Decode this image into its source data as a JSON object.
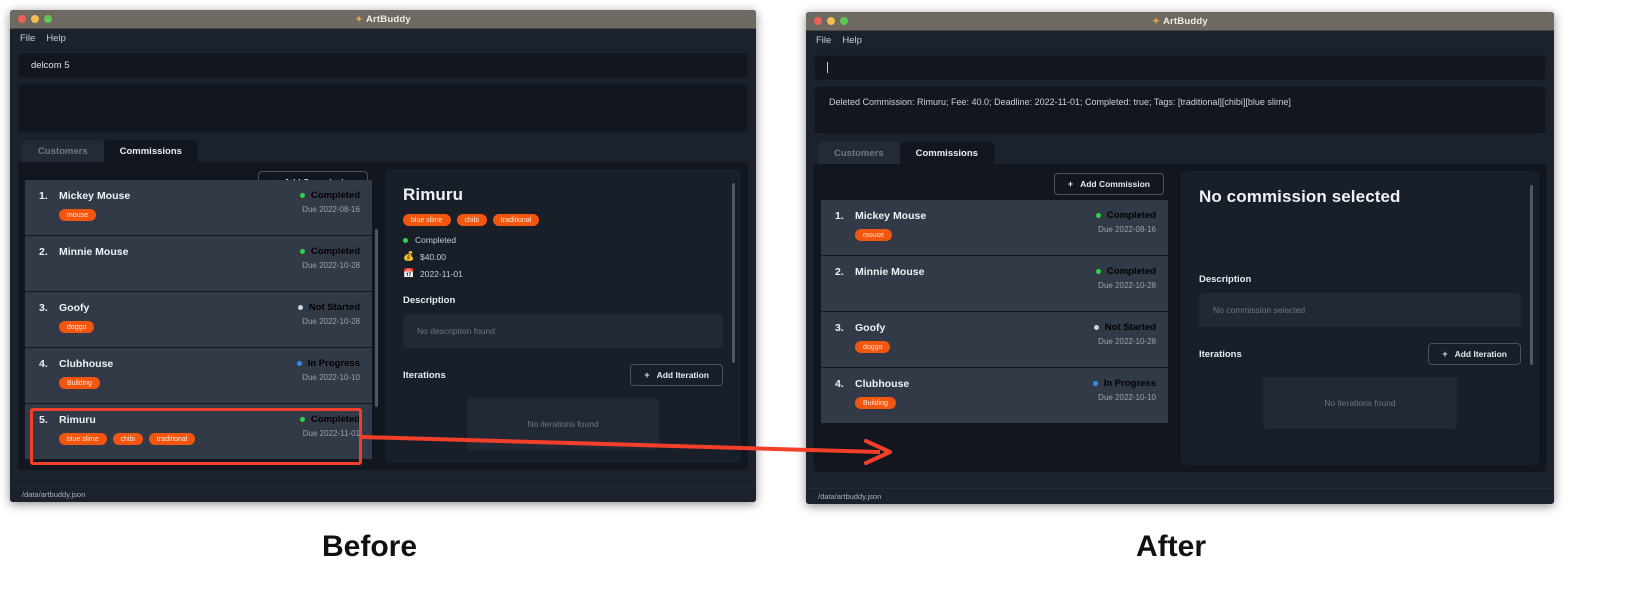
{
  "app": {
    "title": "ArtBuddy",
    "title_glyph": "paint-icon",
    "menu": [
      "File",
      "Help"
    ],
    "statusbar_path": "/data/artbuddy.json"
  },
  "captions": {
    "before": "Before",
    "after": "After"
  },
  "tabs": {
    "customers": "Customers",
    "commissions": "Commissions"
  },
  "buttons": {
    "add_commission": "Add Commission",
    "add_iteration": "Add Iteration",
    "plus": "+"
  },
  "before": {
    "command_value": "delcom 5",
    "output_text": "",
    "commissions": [
      {
        "num": "1.",
        "name": "Mickey Mouse",
        "tags": [
          "mouse"
        ],
        "status": "Completed",
        "status_kind": "green",
        "due": "Due 2022-08-16"
      },
      {
        "num": "2.",
        "name": "Minnie Mouse",
        "tags": [],
        "status": "Completed",
        "status_kind": "green",
        "due": "Due 2022-10-28"
      },
      {
        "num": "3.",
        "name": "Goofy",
        "tags": [
          "doggo"
        ],
        "status": "Not Started",
        "status_kind": "grey",
        "due": "Due 2022-10-28"
      },
      {
        "num": "4.",
        "name": "Clubhouse",
        "tags": [
          "Building"
        ],
        "status": "In Progress",
        "status_kind": "blue",
        "due": "Due 2022-10-10"
      },
      {
        "num": "5.",
        "name": "Rimuru",
        "tags": [
          "blue slime",
          "chibi",
          "traditional"
        ],
        "status": "Completed",
        "status_kind": "green",
        "due": "Due 2022-11-01"
      }
    ],
    "detail": {
      "title": "Rimuru",
      "tags": [
        "blue slime",
        "chibi",
        "traditional"
      ],
      "status": "Completed",
      "fee": "$40.00",
      "deadline": "2022-11-01",
      "description_label": "Description",
      "description_value": "No description found",
      "iterations_label": "Iterations",
      "iterations_empty": "No iterations found"
    }
  },
  "after": {
    "command_value": "",
    "output_text": "Deleted Commission: Rimuru; Fee: 40.0; Deadline: 2022-11-01; Completed: true; Tags: [traditional][chibi][blue slime]",
    "commissions": [
      {
        "num": "1.",
        "name": "Mickey Mouse",
        "tags": [
          "mouse"
        ],
        "status": "Completed",
        "status_kind": "green",
        "due": "Due 2022-08-16"
      },
      {
        "num": "2.",
        "name": "Minnie Mouse",
        "tags": [],
        "status": "Completed",
        "status_kind": "green",
        "due": "Due 2022-10-28"
      },
      {
        "num": "3.",
        "name": "Goofy",
        "tags": [
          "doggo"
        ],
        "status": "Not Started",
        "status_kind": "grey",
        "due": "Due 2022-10-28"
      },
      {
        "num": "4.",
        "name": "Clubhouse",
        "tags": [
          "Building"
        ],
        "status": "In Progress",
        "status_kind": "blue",
        "due": "Due 2022-10-10"
      }
    ],
    "detail": {
      "title": "No commission selected",
      "tags": [],
      "status": "",
      "fee": "",
      "deadline": "",
      "description_label": "Description",
      "description_value": "No commission selected",
      "iterations_label": "Iterations",
      "iterations_empty": "No iterations found"
    }
  },
  "colors": {
    "accent_tag": "#f2560f",
    "annotation": "#f4402a",
    "status_green": "#2fd24a",
    "status_blue": "#2f8ef0",
    "status_grey": "#cfd5dd"
  }
}
